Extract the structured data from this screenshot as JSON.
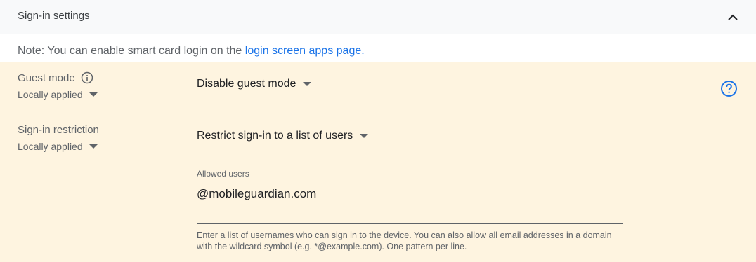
{
  "section": {
    "title": "Sign-in settings",
    "collapse_icon": "chevron-up-icon"
  },
  "note": {
    "text": "Note: You can enable smart card login on the ",
    "link": "login screen apps page."
  },
  "guest_mode": {
    "label": "Guest mode",
    "info_icon": "info-icon",
    "applied": "Locally applied",
    "value": "Disable guest mode"
  },
  "sign_in_restriction": {
    "label": "Sign-in restriction",
    "applied": "Locally applied",
    "value": "Restrict sign-in to a list of users"
  },
  "allowed_users": {
    "label": "Allowed users",
    "value": "@mobileguardian.com",
    "help": "Enter a list of usernames who can sign in to the device. You can also allow all email addresses in a domain with the wildcard symbol (e.g. *@example.com). One pattern per line."
  },
  "help_icon": "help-circle-icon",
  "colors": {
    "header_bg": "#f8f9fa",
    "settings_bg": "#fef4e0",
    "link": "#1a73e8",
    "help_icon": "#1a73e8"
  }
}
